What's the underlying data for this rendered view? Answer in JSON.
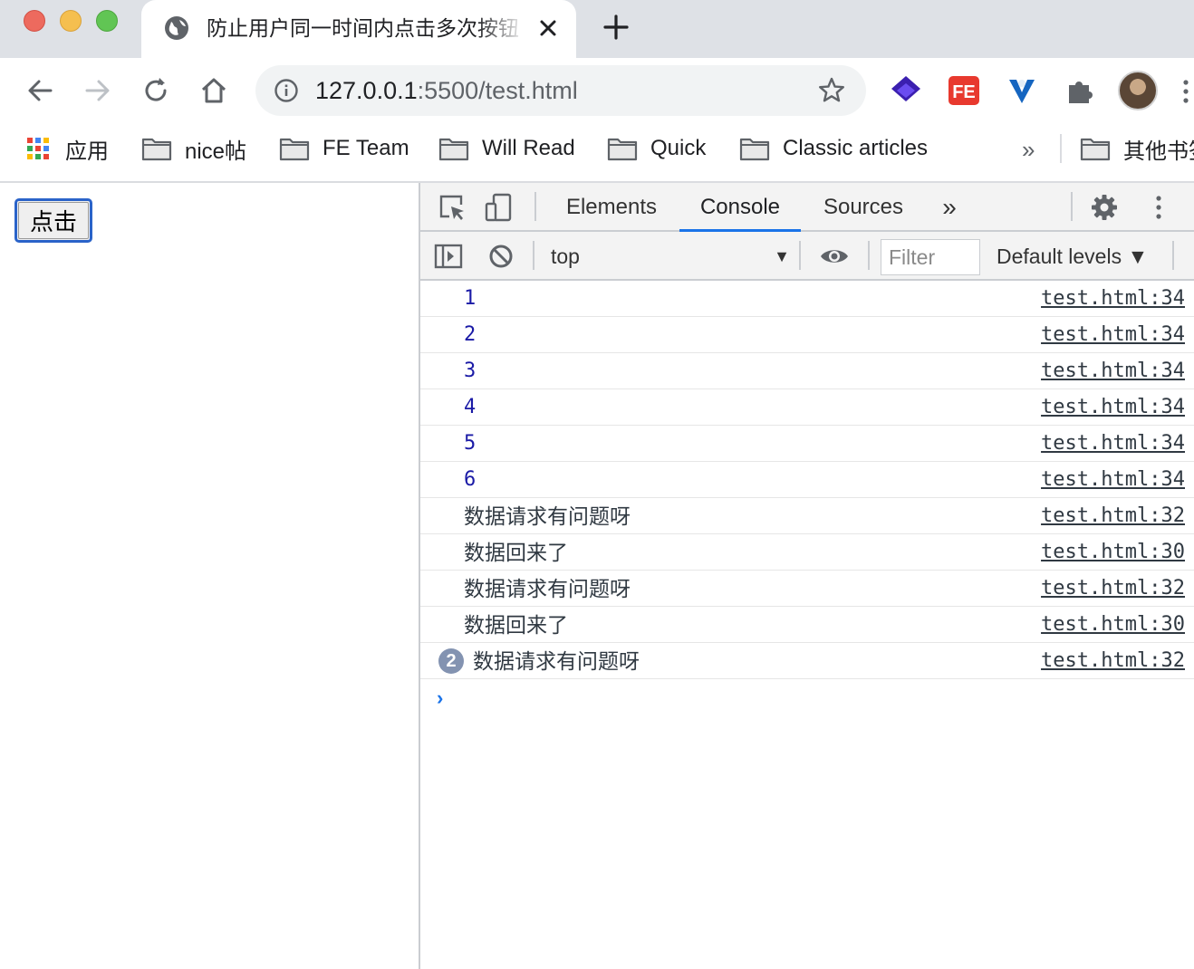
{
  "window": {
    "tab_title": "防止用户同一时间内点击多次按钮",
    "tab_icon": "globe-icon"
  },
  "toolbar": {
    "url_host": "127.0.0.1",
    "url_rest": ":5500/test.html"
  },
  "bookmarks": {
    "apps_label": "应用",
    "items": [
      {
        "label": "nice帖"
      },
      {
        "label": "FE Team"
      },
      {
        "label": "Will Read"
      },
      {
        "label": "Quick"
      },
      {
        "label": "Classic articles"
      }
    ],
    "overflow": "»",
    "other": "其他书签"
  },
  "page": {
    "button_label": "点击"
  },
  "devtools": {
    "tabs": [
      "Elements",
      "Console",
      "Sources"
    ],
    "active_tab": "Console",
    "more_tabs": "»",
    "context": "top",
    "filter_placeholder": "Filter",
    "levels": "Default levels ▼",
    "messages": [
      {
        "text": "1",
        "kind": "number",
        "source": "test.html:34"
      },
      {
        "text": "2",
        "kind": "number",
        "source": "test.html:34"
      },
      {
        "text": "3",
        "kind": "number",
        "source": "test.html:34"
      },
      {
        "text": "4",
        "kind": "number",
        "source": "test.html:34"
      },
      {
        "text": "5",
        "kind": "number",
        "source": "test.html:34"
      },
      {
        "text": "6",
        "kind": "number",
        "source": "test.html:34"
      },
      {
        "text": "数据请求有问题呀",
        "kind": "string",
        "source": "test.html:32"
      },
      {
        "text": "数据回来了",
        "kind": "string",
        "source": "test.html:30"
      },
      {
        "text": "数据请求有问题呀",
        "kind": "string",
        "source": "test.html:32"
      },
      {
        "text": "数据回来了",
        "kind": "string",
        "source": "test.html:30"
      },
      {
        "text": "数据请求有问题呀",
        "kind": "string",
        "source": "test.html:32",
        "repeat": "2"
      }
    ],
    "prompt": "›"
  },
  "colors": {
    "accent": "#1a73e8",
    "console_number": "#1a1aa6",
    "focus_ring": "#2a63c9"
  }
}
